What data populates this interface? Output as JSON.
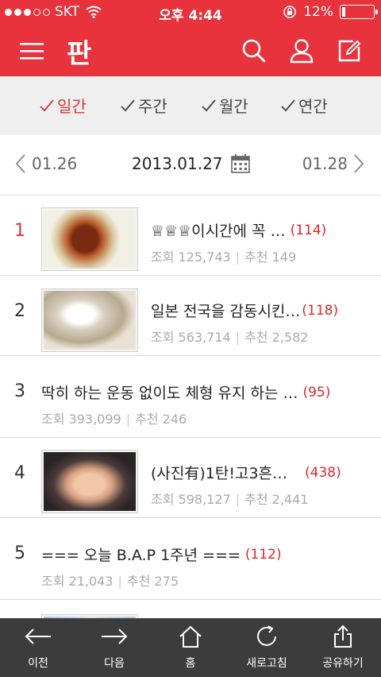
{
  "status_bar": {
    "carrier": "SKT",
    "time": "오후 4:44",
    "battery": "12%",
    "battery_level": 0.12
  },
  "header": {
    "logo": "판"
  },
  "period_tabs": [
    {
      "label": "일간",
      "active": true
    },
    {
      "label": "주간",
      "active": false
    },
    {
      "label": "월간",
      "active": false
    },
    {
      "label": "연간",
      "active": false
    }
  ],
  "date_nav": {
    "prev": "01.26",
    "current": "2013.01.27",
    "next": "01.28"
  },
  "list": [
    {
      "rank": "1",
      "title": "♕♕♕이시간에 꼭 …",
      "count": "(114)",
      "views_label": "조회",
      "views": "125,743",
      "rec_label": "추천",
      "rec": "149",
      "has_thumb": true
    },
    {
      "rank": "2",
      "title": "일본 전국을 감동시킨…",
      "count": "(118)",
      "views_label": "조회",
      "views": "563,714",
      "rec_label": "추천",
      "rec": "2,582",
      "has_thumb": true
    },
    {
      "rank": "3",
      "title": "딱히 하는 운동 없이도 체형 유지 하는 …",
      "count": "(95)",
      "views_label": "조회",
      "views": "393,099",
      "rec_label": "추천",
      "rec": "246",
      "has_thumb": false
    },
    {
      "rank": "4",
      "title": "(사진有)1탄!고3흔녀 …",
      "count": "(438)",
      "views_label": "조회",
      "views": "598,127",
      "rec_label": "추천",
      "rec": "2,441",
      "has_thumb": true
    },
    {
      "rank": "5",
      "title": "=== 오늘 B.A.P 1주년 ===",
      "count": "(112)",
      "views_label": "조회",
      "views": "21,043",
      "rec_label": "추천",
      "rec": "275",
      "has_thumb": false
    }
  ],
  "toolbar": {
    "prev": "이전",
    "next": "다음",
    "home": "홈",
    "refresh": "새로고침",
    "share": "공유하기"
  },
  "colors": {
    "accent": "#e8323c",
    "count_red": "#e0262d",
    "toolbar_bg": "#3c3c3c",
    "tab_bg": "#efefef"
  }
}
